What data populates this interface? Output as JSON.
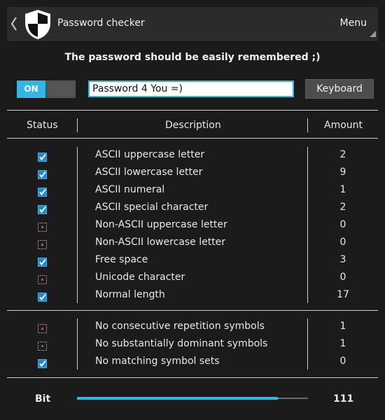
{
  "topbar": {
    "title": "Password checker",
    "menu_label": "Menu"
  },
  "hint": "The password should be easily remembered ;)",
  "toggle": {
    "label": "ON",
    "state": "on"
  },
  "password_input": {
    "value": "Password 4 You =)"
  },
  "keyboard_button": "Keyboard",
  "table": {
    "headers": {
      "status": "Status",
      "description": "Description",
      "amount": "Amount"
    },
    "rows": [
      {
        "status": "pass",
        "description": "ASCII uppercase letter",
        "amount": "2"
      },
      {
        "status": "pass",
        "description": "ASCII lowercase letter",
        "amount": "9"
      },
      {
        "status": "pass",
        "description": "ASCII numeral",
        "amount": "1"
      },
      {
        "status": "pass",
        "description": "ASCII special character",
        "amount": "2"
      },
      {
        "status": "fail",
        "description": "Non-ASCII uppercase letter",
        "amount": "0"
      },
      {
        "status": "fail",
        "description": "Non-ASCII lowercase letter",
        "amount": "0"
      },
      {
        "status": "pass",
        "description": "Free space",
        "amount": "3"
      },
      {
        "status": "fail",
        "description": "Unicode character",
        "amount": "0"
      },
      {
        "status": "pass",
        "description": "Normal length",
        "amount": "17"
      }
    ],
    "rules": [
      {
        "status": "fail",
        "description": "No consecutive repetition symbols",
        "amount": "1"
      },
      {
        "status": "fail",
        "description": "No substantially dominant symbols",
        "amount": "1"
      },
      {
        "status": "pass",
        "description": "No matching symbol sets",
        "amount": "0"
      }
    ]
  },
  "strength": {
    "label": "Bit",
    "value": "111",
    "fill_fraction": 0.87
  },
  "colors": {
    "accent": "#33b5e5",
    "fail": "#e53935",
    "background": "#1b1b1b"
  }
}
